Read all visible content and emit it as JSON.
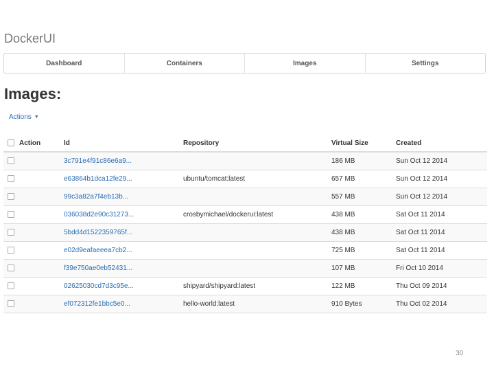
{
  "app": {
    "title": "DockerUI"
  },
  "nav": {
    "items": [
      {
        "label": "Dashboard"
      },
      {
        "label": "Containers"
      },
      {
        "label": "Images"
      },
      {
        "label": "Settings"
      }
    ]
  },
  "page": {
    "title": "Images:"
  },
  "actions": {
    "label": "Actions",
    "caret_icon": "caret-down-icon"
  },
  "table": {
    "headers": {
      "action": "Action",
      "id": "Id",
      "repository": "Repository",
      "virtual_size": "Virtual Size",
      "created": "Created"
    },
    "rows": [
      {
        "id": "3c791e4f91c86e6a9...",
        "repository": "",
        "virtual_size": "186 MB",
        "created": "Sun Oct 12 2014"
      },
      {
        "id": "e63864b1dca12fe29...",
        "repository": "ubuntu/tomcat:latest",
        "virtual_size": "657 MB",
        "created": "Sun Oct 12 2014"
      },
      {
        "id": "99c3a82a7f4eb13b...",
        "repository": "",
        "virtual_size": "557 MB",
        "created": "Sun Oct 12 2014"
      },
      {
        "id": "036038d2e90c31273...",
        "repository": "crosbymichael/dockerui:latest",
        "virtual_size": "438 MB",
        "created": "Sat Oct 11 2014"
      },
      {
        "id": "5bdd4d1522359765f...",
        "repository": "",
        "virtual_size": "438 MB",
        "created": "Sat Oct 11 2014"
      },
      {
        "id": "e02d9eafaeeea7cb2...",
        "repository": "",
        "virtual_size": "725 MB",
        "created": "Sat Oct 11 2014"
      },
      {
        "id": "f39e750ae0eb52431...",
        "repository": "",
        "virtual_size": "107 MB",
        "created": "Fri Oct 10 2014"
      },
      {
        "id": "02625030cd7d3c95e...",
        "repository": "shipyard/shipyard:latest",
        "virtual_size": "122 MB",
        "created": "Thu Oct 09 2014"
      },
      {
        "id": "ef072312fe1bbc5e0...",
        "repository": "hello-world:latest",
        "virtual_size": "910 Bytes",
        "created": "Thu Oct 02 2014"
      }
    ]
  },
  "slide_number": "30",
  "colors": {
    "link": "#2a6db3",
    "border": "#d4d4d4",
    "alt_row": "#f9f9f9"
  }
}
